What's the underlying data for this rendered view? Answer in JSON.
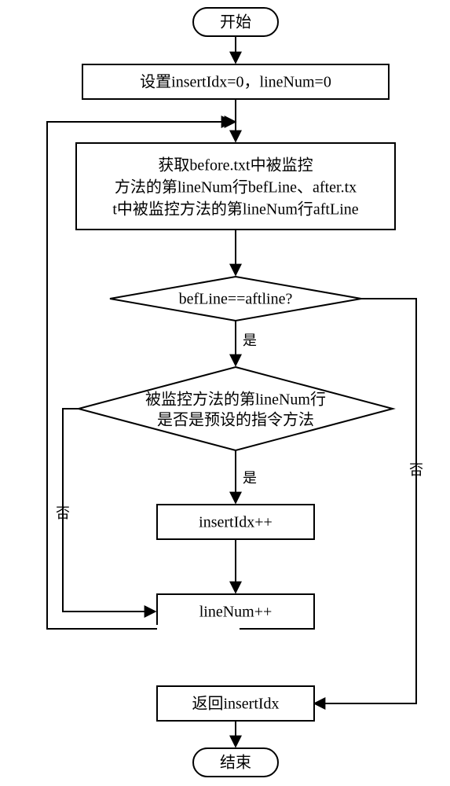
{
  "start": "开始",
  "end": "结束",
  "init": "设置insertIdx=0，lineNum=0",
  "fetch_l1": "获取before.txt中被监控",
  "fetch_l2": "方法的第lineNum行befLine、after.tx",
  "fetch_l3": "t中被监控方法的第lineNum行aftLine",
  "dec1": "befLine==aftline?",
  "dec2_l1": "被监控方法的第lineNum行",
  "dec2_l2": "是否是预设的指令方法",
  "inc1": "insertIdx++",
  "inc2": "lineNum++",
  "ret": "返回insertIdx",
  "yes": "是",
  "no": "否"
}
